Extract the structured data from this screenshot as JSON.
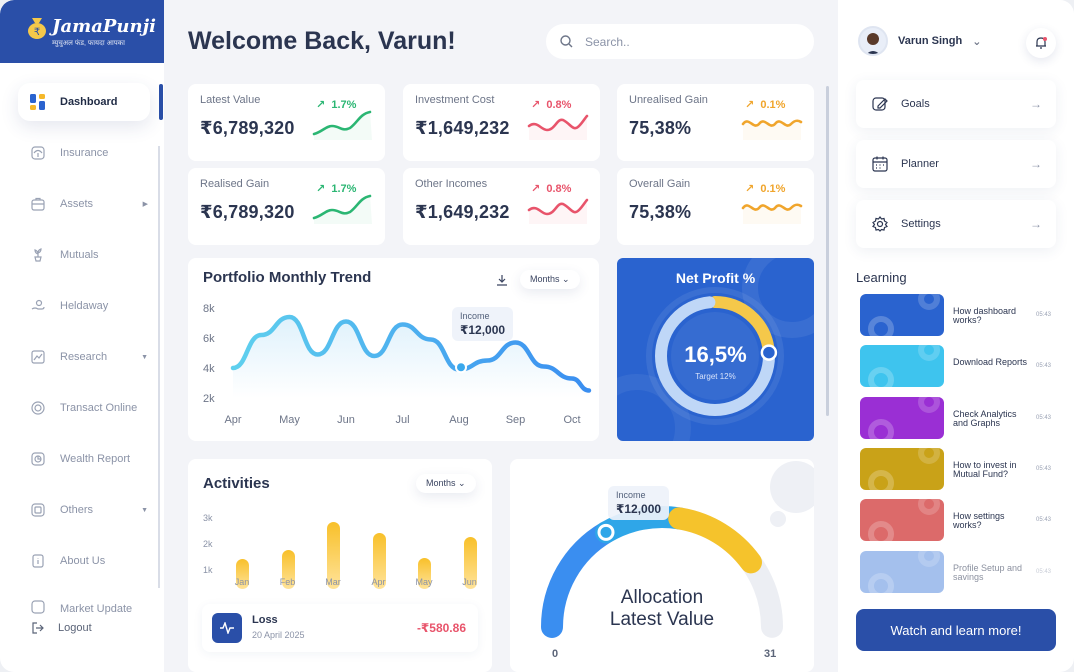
{
  "brand": {
    "name": "JamaPunji",
    "tagline": "म्युचुअल फंड, फायदा आपका"
  },
  "sidebar": {
    "items": [
      {
        "label": "Dashboard",
        "icon": "dashboard-icon"
      },
      {
        "label": "Insurance",
        "icon": "umbrella-icon"
      },
      {
        "label": "Assets",
        "icon": "briefcase-icon"
      },
      {
        "label": "Mutuals",
        "icon": "plant-icon"
      },
      {
        "label": "Heldaway",
        "icon": "hand-coin-icon"
      },
      {
        "label": "Research",
        "icon": "chart-icon"
      },
      {
        "label": "Transact Online",
        "icon": "coin-icon"
      },
      {
        "label": "Wealth Report",
        "icon": "report-icon"
      },
      {
        "label": "Others",
        "icon": "box-icon"
      },
      {
        "label": "About Us",
        "icon": "info-icon"
      },
      {
        "label": "Market Update",
        "icon": "bell-icon"
      }
    ],
    "logout": "Logout"
  },
  "header": {
    "welcome": "Welcome Back, Varun!",
    "search_placeholder": "Search.."
  },
  "stats": [
    {
      "label": "Latest Value",
      "value": "₹6,789,320",
      "change": "1.7%",
      "trend": "up"
    },
    {
      "label": "Investment Cost",
      "value": "₹1,649,232",
      "change": "0.8%",
      "trend": "down"
    },
    {
      "label": "Unrealised Gain",
      "value": "75,38%",
      "change": "0.1%",
      "trend": "flat"
    },
    {
      "label": "Realised Gain",
      "value": "₹6,789,320",
      "change": "1.7%",
      "trend": "up"
    },
    {
      "label": "Other Incomes",
      "value": "₹1,649,232",
      "change": "0.8%",
      "trend": "down"
    },
    {
      "label": "Overall Gain",
      "value": "75,38%",
      "change": "0.1%",
      "trend": "flat"
    }
  ],
  "trend": {
    "title": "Portfolio Monthly Trend",
    "period": "Months",
    "tooltip_label": "Income",
    "tooltip_value": "₹12,000"
  },
  "chart_data": [
    {
      "type": "line",
      "title": "Portfolio Monthly Trend",
      "categories": [
        "Apr",
        "May",
        "Jun",
        "Jul",
        "Aug",
        "Sep",
        "Oct"
      ],
      "y_ticks": [
        "8k",
        "6k",
        "4k",
        "2k"
      ],
      "ylim": [
        2000,
        8000
      ],
      "grid": false,
      "x": [
        0,
        0.5,
        1,
        1.5,
        2,
        2.5,
        3,
        3.5,
        4,
        4.5,
        5,
        5.5,
        6,
        6.3
      ],
      "values": [
        4000,
        6200,
        7400,
        4900,
        7100,
        4800,
        6900,
        5900,
        3900,
        4500,
        5700,
        4100,
        3300,
        2500
      ],
      "highlight": {
        "category": "Aug",
        "label": "Income",
        "value": 12000
      }
    },
    {
      "type": "bar",
      "title": "Activities",
      "categories": [
        "Jan",
        "Feb",
        "Mar",
        "Apr",
        "May",
        "Jun"
      ],
      "y_ticks": [
        "3k",
        "2k",
        "1k"
      ],
      "ylim": [
        1000,
        3000
      ],
      "values": [
        1450,
        1800,
        2900,
        2450,
        1500,
        2300
      ]
    },
    {
      "type": "gauge",
      "title": "Allocation Latest Value",
      "min": 0,
      "max": 31,
      "segments": [
        {
          "color": "#3a8ef0",
          "fraction": 0.33
        },
        {
          "color": "#2fa6e8",
          "fraction": 0.22
        },
        {
          "color": "#f5c32c",
          "fraction": 0.25
        },
        {
          "color": "#e9ebf1",
          "fraction": 0.2
        }
      ],
      "highlight": {
        "label": "Income",
        "value": "₹12,000"
      }
    },
    {
      "type": "donut",
      "title": "Net Profit %",
      "value": 16.5,
      "value_text": "16,5%",
      "target_text": "Target 12%",
      "segments": [
        {
          "color": "#f5c84a",
          "fraction": 0.24
        },
        {
          "color": "#bfd7f7",
          "fraction": 0.76
        }
      ]
    }
  ],
  "netprofit": {
    "title": "Net Profit %",
    "value": "16,5%",
    "target": "Target 12%"
  },
  "activities": {
    "title": "Activities",
    "period": "Months",
    "transaction": {
      "title": "Loss",
      "date": "20 April 2025",
      "amount": "-₹580.86"
    }
  },
  "allocation": {
    "title_line1": "Allocation",
    "title_line2": "Latest Value",
    "min": "0",
    "max": "31",
    "tooltip_label": "Income",
    "tooltip_value": "₹12,000"
  },
  "right": {
    "user": "Varun Singh",
    "actions": [
      {
        "label": "Goals",
        "icon": "edit-icon"
      },
      {
        "label": "Planner",
        "icon": "calendar-icon"
      },
      {
        "label": "Settings",
        "icon": "gear-icon"
      }
    ],
    "learning_title": "Learning",
    "learning": [
      {
        "title": "How dashboard works?",
        "time": "05:43",
        "color": "#2a63cf"
      },
      {
        "title": "Download Reports",
        "time": "05:43",
        "color": "#3ec4ee"
      },
      {
        "title": "Check Analytics and Graphs",
        "time": "05:43",
        "color": "#9a2fd4"
      },
      {
        "title": "How to invest in Mutual Fund?",
        "time": "05:43",
        "color": "#c9a218"
      },
      {
        "title": "How settings works?",
        "time": "05:43",
        "color": "#dc6a6a"
      },
      {
        "title": "Profile Setup and savings",
        "time": "05:43",
        "color": "#5a8ee0"
      }
    ],
    "watch": "Watch and learn more!"
  },
  "colors": {
    "brand": "#2a4fa8",
    "up": "#2bb673",
    "down": "#e8546b",
    "flat": "#f0a52c"
  }
}
